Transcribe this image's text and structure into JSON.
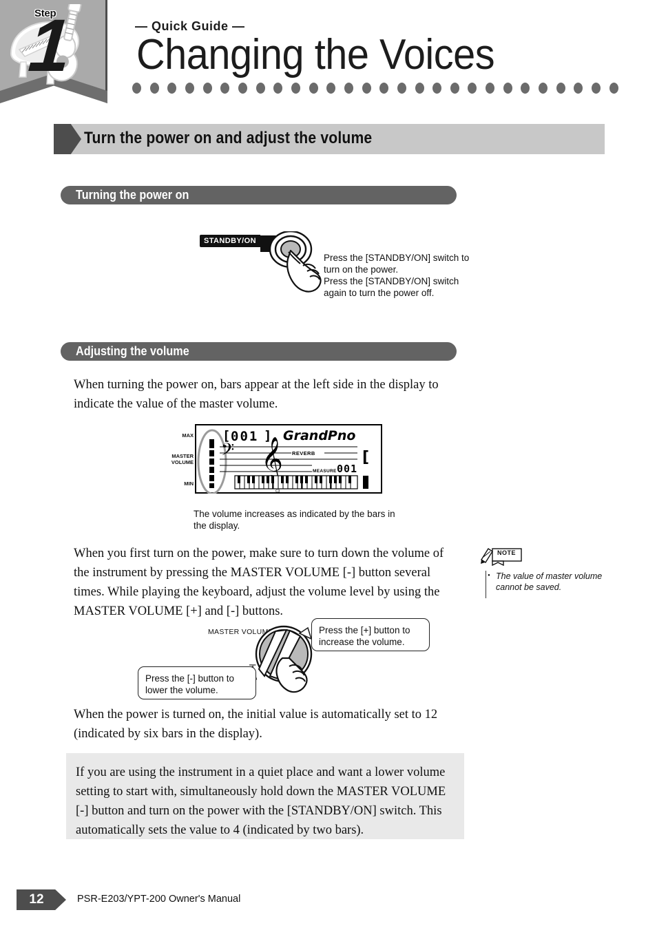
{
  "header": {
    "step_word": "Step",
    "step_number": "1",
    "eyebrow": "— Quick Guide —",
    "title": "Changing the Voices",
    "dot_count": 28,
    "badge_icon": "piano-guitar-illustration"
  },
  "section": {
    "title": "Turn the power on and adjust the volume",
    "arrow_icon": "chevron-right-icon"
  },
  "subsections": [
    {
      "label": "Turning the power on"
    },
    {
      "label": "Adjusting the volume"
    }
  ],
  "power_illustration": {
    "button_tag": "STANDBY/ON",
    "button_icon": "round-power-button",
    "hand_icon": "pointing-hand-icon",
    "caption": "Press the [STANDBY/ON] switch to turn on the power.\nPress the [STANDBY/ON] switch again to turn the power off."
  },
  "volume_intro": "When turning the power on, bars appear at the left side in the display to indicate the value of the master volume.",
  "lcd": {
    "labels": {
      "max": "MAX",
      "master_volume": "MASTER\nVOLUME",
      "min": "MIN"
    },
    "voice_number": "001",
    "voice_name": "GrandPno",
    "reverb_label": "REVERB",
    "measure_label": "MEASURE",
    "measure_value": "001",
    "keyboard_marker": "C3",
    "bar_count": 6,
    "ellipse_icon": "highlight-ellipse",
    "caption": "The volume increases as indicated by the bars in the display."
  },
  "volume_body": "When you first turn on the power, make sure to turn down the volume of the instrument by pressing the MASTER VOLUME [-] button several times. While playing the keyboard, adjust the volume level by using the MASTER VOLUME [+] and [-] buttons.",
  "note": {
    "tag": "NOTE",
    "tag_icon": "pencil-note-icon",
    "bullet": "•",
    "text": "The value of master volume cannot be saved."
  },
  "knob_illustration": {
    "label": "MASTER VOLUME",
    "knob_icon": "rotary-knob-icon",
    "hand_icon": "pointing-hand-icon",
    "plus_sign": "+",
    "minus_sign": "–",
    "callout_plus": "Press the [+] button to increase the volume.",
    "callout_minus": "Press the [-] button to lower the volume."
  },
  "initial_value_text": "When the power is turned on, the initial value is automatically set to 12 (indicated by six bars in the display).",
  "info_box": {
    "text": "If you are using the instrument in a quiet place and want a lower volume setting to start with, simultaneously hold down the MASTER VOLUME [-] button and turn on the power with the [STANDBY/ON] switch.  This automatically sets the value to 4 (indicated by two bars)."
  },
  "footer": {
    "page_number": "12",
    "text": "PSR-E203/YPT-200   Owner's Manual"
  },
  "colors": {
    "badge_gray": "#aaaaaa",
    "section_bar_gray": "#c8c8c8",
    "arrow_dark": "#4d4d4d",
    "pill_gray": "#636363",
    "dot_gray": "#6b6b6b",
    "info_box_gray": "#e9e9e9"
  }
}
